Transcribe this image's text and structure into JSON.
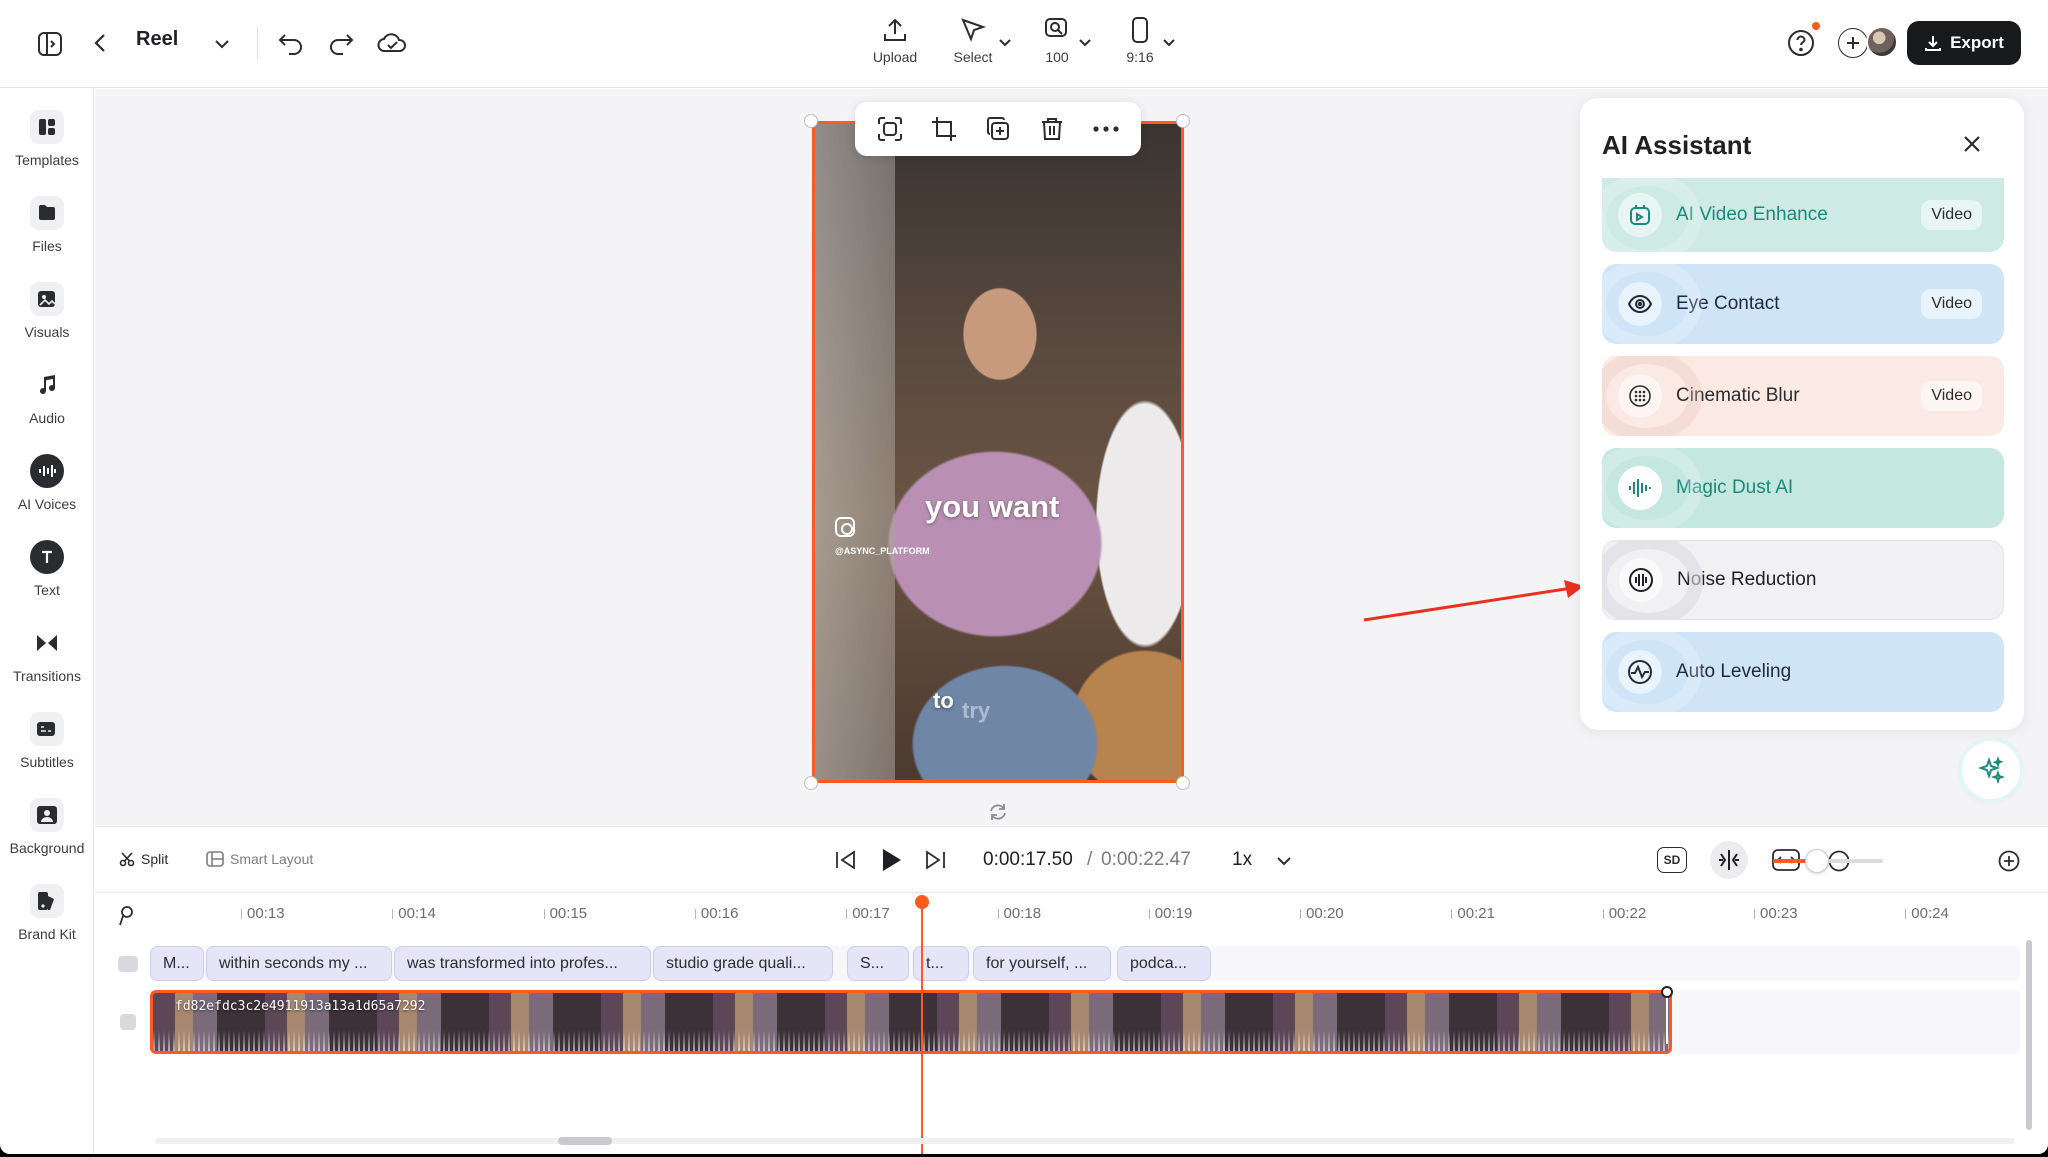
{
  "header": {
    "project_name": "Reel",
    "upload_label": "Upload",
    "select_label": "Select",
    "zoom_label": "100",
    "ratio_label": "9:16",
    "export_label": "Export",
    "help_label": "?"
  },
  "sidebar": {
    "items": [
      {
        "label": "Templates",
        "icon": "templates-icon"
      },
      {
        "label": "Files",
        "icon": "folder-icon"
      },
      {
        "label": "Visuals",
        "icon": "image-plus-icon"
      },
      {
        "label": "Audio",
        "icon": "music-note-icon"
      },
      {
        "label": "AI Voices",
        "icon": "voice-wave-icon"
      },
      {
        "label": "Text",
        "icon": "text-icon"
      },
      {
        "label": "Transitions",
        "icon": "bowtie-icon"
      },
      {
        "label": "Subtitles",
        "icon": "subtitle-icon"
      },
      {
        "label": "Background",
        "icon": "background-icon"
      },
      {
        "label": "Brand Kit",
        "icon": "brand-kit-icon"
      }
    ]
  },
  "canvas": {
    "overlay_text_1": "you want",
    "overlay_text_2": "to",
    "overlay_text_3": "try",
    "ig_handle": "@ASYNC_PLATFORM"
  },
  "ai_panel": {
    "title": "AI Assistant",
    "cards": [
      {
        "label": "AI Video Enhance",
        "badge": "Video",
        "bg": "#cdeae5",
        "fg": "#1b8a7b"
      },
      {
        "label": "Eye Contact",
        "badge": "Video",
        "bg": "#cfe4f7",
        "fg": "#1f2a3a"
      },
      {
        "label": "Cinematic Blur",
        "badge": "Video",
        "bg": "#fbe9e3",
        "fg": "#2b2c30"
      },
      {
        "label": "Magic Dust AI",
        "badge": "",
        "bg": "#c4e7e0",
        "fg": "#1b8a7b"
      },
      {
        "label": "Noise Reduction",
        "badge": "",
        "bg": "#f1f1f3",
        "fg": "#1f2024"
      },
      {
        "label": "Auto Leveling",
        "badge": "",
        "bg": "#cfe4f7",
        "fg": "#1f2a3a"
      }
    ]
  },
  "controls": {
    "split_label": "Split",
    "smart_layout_label": "Smart Layout",
    "time_now": "0:00:17.50",
    "time_sep": "/",
    "time_total": "0:00:22.47",
    "speed": "1x",
    "sd_label": "SD",
    "zoom_level": 0.4
  },
  "timeline": {
    "ticks": [
      "00:13",
      "00:14",
      "00:15",
      "00:16",
      "00:17",
      "00:18",
      "00:19",
      "00:20",
      "00:21",
      "00:22",
      "00:23",
      "00:24"
    ],
    "subtitles": [
      "M...",
      "within seconds my ...",
      "was transformed into profes...",
      "studio grade quali...",
      "S...",
      "t...",
      "for yourself, ...",
      "podca..."
    ],
    "clip_name": "fd82efdc3c2e4911913a13a1d65a7292"
  },
  "colors": {
    "accent": "#ff5a1f",
    "teal": "#1b8a7b"
  }
}
